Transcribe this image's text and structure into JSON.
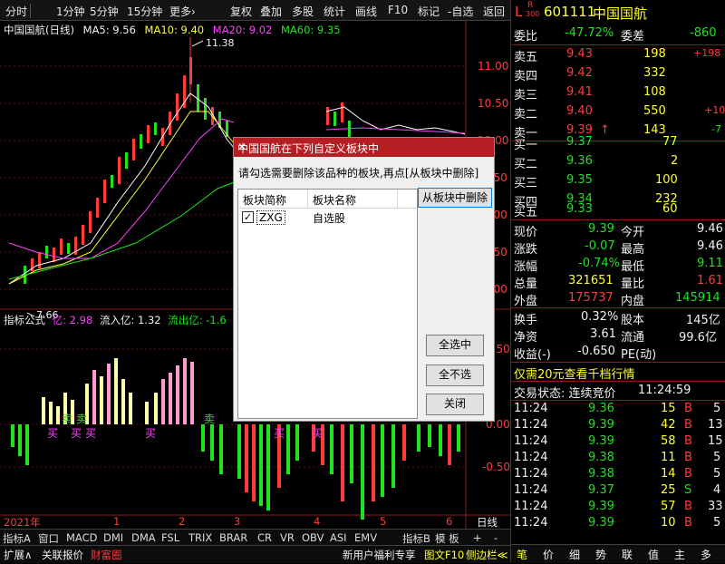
{
  "toolbar": {
    "items": [
      "分时",
      "1分钟",
      "5分钟",
      "15分钟",
      "更多›",
      "复权",
      "叠加",
      "多股",
      "统计",
      "画线",
      "F10",
      "标记",
      "-自选",
      "返回"
    ]
  },
  "chart_header": {
    "title": "中国国航(日线)",
    "ma5": "MA5: 9.56",
    "ma10": "MA10: 9.40",
    "ma20": "MA20: 9.02",
    "ma60": "MA60: 9.35"
  },
  "price_axis": [
    "11.00",
    "10.50",
    "10.00",
    "9.50",
    "9.00",
    "8.50",
    "8.00",
    "7.50"
  ],
  "annotations": {
    "high": "11.38",
    "low": "7.66"
  },
  "indicator": {
    "name": "指标公式",
    "v1": "亿: 2.98",
    "v2": "流入亿: 1.32",
    "v3": "流出亿: -1.6",
    "axis": [
      "0.50",
      "0.00",
      "-0.50"
    ],
    "buy_label": "买",
    "sell_label": "卖"
  },
  "time_axis": {
    "year": "2021年",
    "months": [
      "1",
      "2",
      "3",
      "4",
      "5",
      "6"
    ],
    "period": "日线"
  },
  "indicator_tabs": [
    "指标A",
    "窗口",
    "MACD",
    "DMI",
    "DMA",
    "FSL",
    "TRIX",
    "BRAR",
    "CR",
    "VR",
    "OBV",
    "ASI",
    "EMV"
  ],
  "indicator_tabs_right": [
    "指标B",
    "模 板",
    "+",
    "-"
  ],
  "bottom_bar": {
    "expand": "扩展∧",
    "link": "关联报价",
    "wealth": "财富圈",
    "promo": "新用户福利专享",
    "f10": "图文F10",
    "side": "侧边栏≪"
  },
  "quote": {
    "code": "601111",
    "name": "中国国航",
    "mark_l": "L",
    "mark_r": "R",
    "mark_num": "300",
    "weibi_label": "委比",
    "weibi": "-47.72%",
    "weicha_label": "委差",
    "weicha": "-860",
    "sells": [
      {
        "label": "卖五",
        "price": "9.43",
        "vol": "198",
        "chg": "+198"
      },
      {
        "label": "卖四",
        "price": "9.42",
        "vol": "332",
        "chg": ""
      },
      {
        "label": "卖三",
        "price": "9.41",
        "vol": "108",
        "chg": ""
      },
      {
        "label": "卖二",
        "price": "9.40",
        "vol": "550",
        "chg": "+10"
      },
      {
        "label": "卖一",
        "price": "9.39",
        "vol": "143",
        "chg": "-7",
        "arrow": "↑"
      }
    ],
    "buys": [
      {
        "label": "买一",
        "price": "9.37",
        "vol": "77"
      },
      {
        "label": "买二",
        "price": "9.36",
        "vol": "2"
      },
      {
        "label": "买三",
        "price": "9.35",
        "vol": "100"
      },
      {
        "label": "买四",
        "price": "9.34",
        "vol": "232"
      },
      {
        "label": "买五",
        "price": "9.33",
        "vol": "60"
      }
    ],
    "stats": [
      {
        "l1": "现价",
        "v1": "9.39",
        "l2": "今开",
        "v2": "9.46"
      },
      {
        "l1": "涨跌",
        "v1": "-0.07",
        "l2": "最高",
        "v2": "9.46"
      },
      {
        "l1": "涨幅",
        "v1": "-0.74%",
        "l2": "最低",
        "v2": "9.11"
      },
      {
        "l1": "总量",
        "v1": "321651",
        "l2": "量比",
        "v2": "1.61"
      },
      {
        "l1": "外盘",
        "v1": "175737",
        "l2": "内盘",
        "v2": "145914"
      }
    ],
    "stats2": [
      {
        "l1": "换手",
        "v1": "0.32%",
        "l2": "股本",
        "v2": "145亿"
      },
      {
        "l1": "净资",
        "v1": "3.61",
        "l2": "流通",
        "v2": "99.6亿"
      },
      {
        "l1": "收益(-)",
        "v1": "-0.650",
        "l2": "PE(动)",
        "v2": ""
      }
    ],
    "promo": "仅需20元查看千档行情",
    "status_label": "交易状态: 连续竞价",
    "status_time": "11:24:59",
    "ticks": [
      {
        "t": "11:24",
        "p": "9.36",
        "v": "15",
        "d": "B",
        "n": "5"
      },
      {
        "t": "11:24",
        "p": "9.39",
        "v": "42",
        "d": "B",
        "n": "13"
      },
      {
        "t": "11:24",
        "p": "9.39",
        "v": "58",
        "d": "B",
        "n": "15"
      },
      {
        "t": "11:24",
        "p": "9.38",
        "v": "11",
        "d": "B",
        "n": "5"
      },
      {
        "t": "11:24",
        "p": "9.38",
        "v": "14",
        "d": "B",
        "n": "5"
      },
      {
        "t": "11:24",
        "p": "9.37",
        "v": "25",
        "d": "S",
        "n": "4"
      },
      {
        "t": "11:24",
        "p": "9.39",
        "v": "57",
        "d": "B",
        "n": "33"
      },
      {
        "t": "11:24",
        "p": "9.39",
        "v": "10",
        "d": "B",
        "n": "5"
      }
    ],
    "bottom_tabs": [
      "笔",
      "价",
      "细",
      "势",
      "联",
      "值",
      "主",
      "多"
    ]
  },
  "dialog": {
    "title": "中国国航在下列自定义板块中",
    "close": "✕",
    "desc": "请勾选需要删除该品种的板块,再点[从板块中删除]",
    "col1": "板块简称",
    "col2": "板块名称",
    "row_code": "ZXG",
    "row_name": "自选股",
    "row_checked": true,
    "remove_btn": "从板块中删除",
    "select_all": "全选中",
    "select_none": "全不选",
    "close_btn": "关闭"
  },
  "colors": {
    "up": "#ff3b3b",
    "down": "#1ee31e",
    "dialog_title": "#b51f24"
  }
}
